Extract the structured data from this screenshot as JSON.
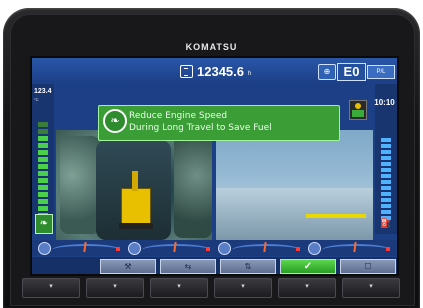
{
  "brand": "KOMATSU",
  "topbar": {
    "hour_meter": "12345.6",
    "hour_unit": "h",
    "mode_icon": "travel-mode-icon",
    "work_mode": "E0",
    "power_label": "P/L"
  },
  "left_panel": {
    "coolant_value": "123.4",
    "coolant_unit": "°C"
  },
  "clock": "10:10",
  "message": {
    "line1": "Reduce Engine Speed",
    "line2": "During Long Travel to Save Fuel"
  },
  "function_keys": [
    {
      "label": "⚒"
    },
    {
      "label": "⇆"
    },
    {
      "label": "⇅"
    },
    {
      "label": "✓"
    },
    {
      "label": "☐"
    }
  ],
  "hardware_buttons": [
    "▾",
    "▾",
    "▾",
    "▾",
    "▾",
    "▾"
  ],
  "colors": {
    "screen_bg": "#1d3f86",
    "message_bg": "#3a9d35",
    "ok_key": "#2a9e23"
  }
}
